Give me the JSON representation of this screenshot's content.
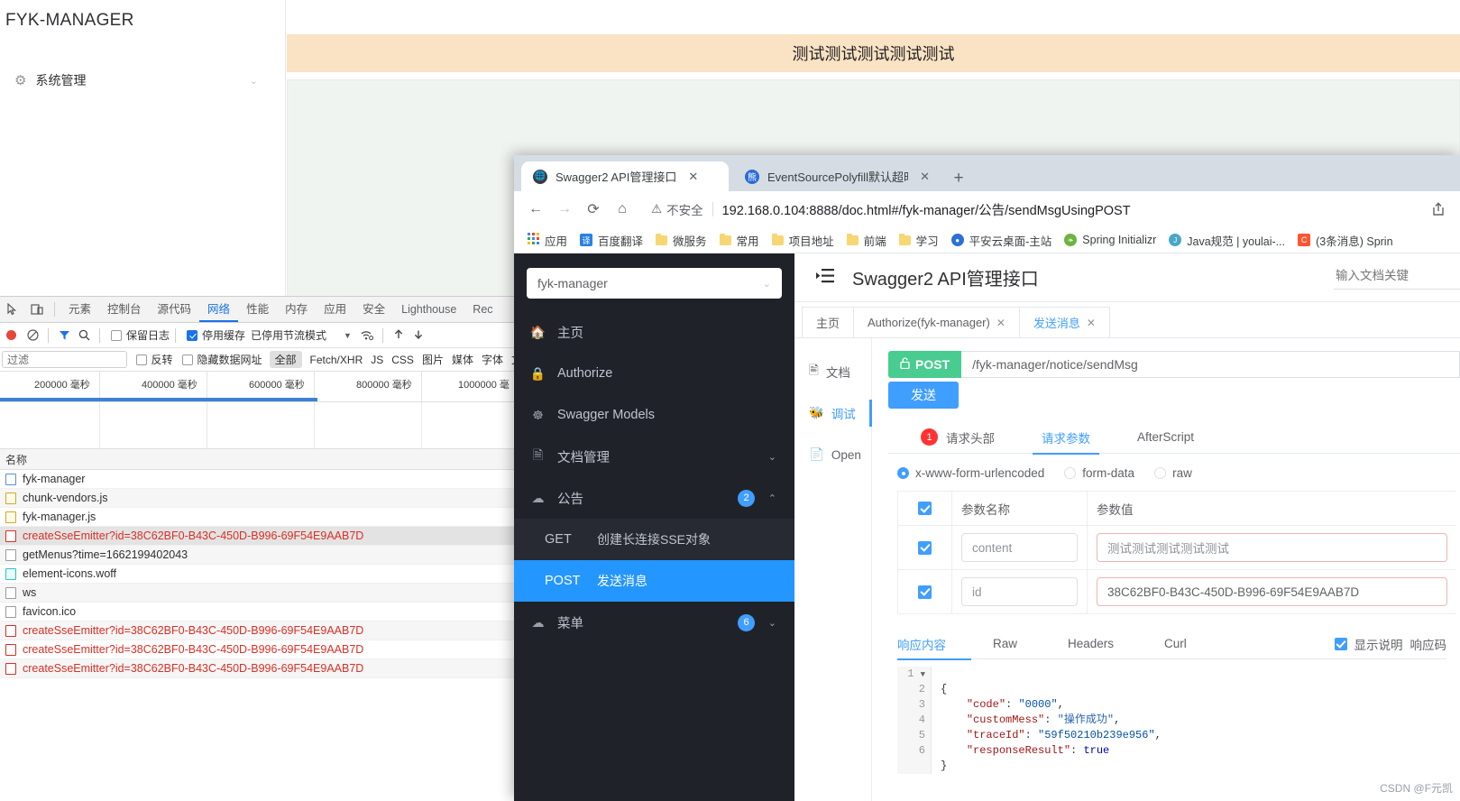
{
  "bg_app": {
    "logo": "FYK-MANAGER",
    "collapse_icon": "menu-fold-icon",
    "menu": {
      "label": "系统管理",
      "icon": "gear-icon",
      "chevron": "⌄"
    },
    "notice_text": "测试测试测试测试测试"
  },
  "devtools": {
    "inspect_icon": "inspect-element-icon",
    "device_icon": "device-toolbar-icon",
    "tabs": [
      {
        "label": "元素",
        "active": false
      },
      {
        "label": "控制台",
        "active": false
      },
      {
        "label": "源代码",
        "active": false
      },
      {
        "label": "网络",
        "active": true
      },
      {
        "label": "性能",
        "active": false
      },
      {
        "label": "内存",
        "active": false
      },
      {
        "label": "应用",
        "active": false
      },
      {
        "label": "安全",
        "active": false
      },
      {
        "label": "Lighthouse",
        "active": false
      },
      {
        "label": "Rec",
        "active": false
      }
    ],
    "toolbar": {
      "record_icon": "record-stop-icon",
      "clear_icon": "clear-icon",
      "filter_icon": "filter-funnel-icon",
      "search_icon": "search-icon",
      "preserve_log": "保留日志",
      "preserve_log_checked": false,
      "disable_cache": "停用缓存",
      "disable_cache_checked": true,
      "throttle": "已停用节流模式",
      "throttle_caret": "▼",
      "wifi_icon": "network-conditions-icon",
      "import_icon": "import-har-icon",
      "export_icon": "export-har-icon"
    },
    "filterbar": {
      "filter_placeholder": "过滤",
      "invert": "反转",
      "invert_checked": false,
      "hide_data_urls": "隐藏数据网址",
      "hide_data_urls_checked": false,
      "types": [
        "全部",
        "Fetch/XHR",
        "JS",
        "CSS",
        "图片",
        "媒体",
        "字体",
        "文"
      ],
      "selected_type": "全部"
    },
    "timeline_ticks": [
      "200000 毫秒",
      "400000 毫秒",
      "600000 毫秒",
      "800000 毫秒",
      "1000000 毫"
    ],
    "list_header": "名称",
    "requests": [
      {
        "name": "fyk-manager",
        "icon": "document-icon",
        "error": false,
        "selected": false
      },
      {
        "name": "chunk-vendors.js",
        "icon": "script-icon",
        "error": false,
        "selected": false
      },
      {
        "name": "fyk-manager.js",
        "icon": "script-icon",
        "error": false,
        "selected": false
      },
      {
        "name": "createSseEmitter?id=38C62BF0-B43C-450D-B996-69F54E9AAB7D",
        "icon": "other-icon",
        "error": true,
        "selected": true
      },
      {
        "name": "getMenus?time=1662199402043",
        "icon": "other-icon",
        "error": false,
        "selected": false
      },
      {
        "name": "element-icons.woff",
        "icon": "font-icon",
        "error": false,
        "selected": false
      },
      {
        "name": "ws",
        "icon": "other-icon",
        "error": false,
        "selected": false
      },
      {
        "name": "favicon.ico",
        "icon": "other-icon",
        "error": false,
        "selected": false
      },
      {
        "name": "createSseEmitter?id=38C62BF0-B43C-450D-B996-69F54E9AAB7D",
        "icon": "other-icon",
        "error": true,
        "selected": false
      },
      {
        "name": "createSseEmitter?id=38C62BF0-B43C-450D-B996-69F54E9AAB7D",
        "icon": "other-icon",
        "error": true,
        "selected": false
      },
      {
        "name": "createSseEmitter?id=38C62BF0-B43C-450D-B996-69F54E9AAB7D",
        "icon": "other-icon",
        "error": true,
        "selected": false
      }
    ]
  },
  "browser": {
    "tabs": [
      {
        "title": "Swagger2 API管理接口",
        "favicon": "globe-icon",
        "favicon_color": "#3c3c3c",
        "active": true
      },
      {
        "title": "EventSourcePolyfill默认超时时",
        "favicon": "baidu-icon",
        "favicon_color": "#2b6cd4",
        "active": false
      }
    ],
    "new_tab_label": "+",
    "nav": {
      "back": "←",
      "forward": "→",
      "reload": "⟳",
      "home": "⌂"
    },
    "security_label": "不安全",
    "security_icon": "warning-triangle-icon",
    "url": "192.168.0.104:8888/doc.html#/fyk-manager/公告/sendMsgUsingPOST",
    "share_icon": "share-icon",
    "bookmarks": [
      {
        "label": "应用",
        "icon": "apps-grid-icon",
        "type": "apps"
      },
      {
        "label": "百度翻译",
        "icon": "translate-icon",
        "type": "square",
        "color": "#2a7fe8",
        "glyph": "译"
      },
      {
        "label": "微服务",
        "icon": "folder-icon",
        "type": "folder"
      },
      {
        "label": "常用",
        "icon": "folder-icon",
        "type": "folder"
      },
      {
        "label": "项目地址",
        "icon": "folder-icon",
        "type": "folder"
      },
      {
        "label": "前端",
        "icon": "folder-icon",
        "type": "folder"
      },
      {
        "label": "学习",
        "icon": "folder-icon",
        "type": "folder"
      },
      {
        "label": "平安云桌面-主站",
        "icon": "pingan-icon",
        "type": "circle",
        "color": "#2e6fd8",
        "glyph": "●"
      },
      {
        "label": "Spring Initializr",
        "icon": "spring-leaf-icon",
        "type": "circle",
        "color": "#6db33f",
        "glyph": "❧"
      },
      {
        "label": "Java规范 | youlai-...",
        "icon": "java-icon",
        "type": "circle",
        "color": "#49a7c8",
        "glyph": "☕"
      },
      {
        "label": "(3条消息) Sprin",
        "icon": "csdn-icon",
        "type": "square",
        "color": "#fc5531",
        "glyph": "C"
      }
    ]
  },
  "swagger": {
    "service_select": {
      "value": "fyk-manager",
      "chevron": "⌄"
    },
    "sidebar": [
      {
        "label": "主页",
        "icon": "home-icon",
        "badge": null,
        "chevron": null
      },
      {
        "label": "Authorize",
        "icon": "lock-icon",
        "badge": null,
        "chevron": null
      },
      {
        "label": "Swagger Models",
        "icon": "cube-icon",
        "badge": null,
        "chevron": null
      },
      {
        "label": "文档管理",
        "icon": "doc-settings-icon",
        "badge": null,
        "chevron": "⌄"
      },
      {
        "label": "公告",
        "icon": "cloud-icon",
        "badge": "2",
        "chevron": "⌃"
      }
    ],
    "sidebar_sub": [
      {
        "method": "GET",
        "label": "创建长连接SSE对象",
        "active": false
      },
      {
        "method": "POST",
        "label": "发送消息",
        "active": true
      }
    ],
    "sidebar_after": [
      {
        "label": "菜单",
        "icon": "cloud-icon",
        "badge": "6",
        "chevron": "⌄"
      }
    ],
    "topbar": {
      "collapse_icon": "sidebar-collapse-icon",
      "title": "Swagger2 API管理接口",
      "search_placeholder": "输入文档关键"
    },
    "tabs": [
      {
        "label": "主页",
        "closable": false,
        "active": false
      },
      {
        "label": "Authorize(fyk-manager)",
        "closable": true,
        "active": false
      },
      {
        "label": "发送消息",
        "closable": true,
        "active": true
      }
    ],
    "left_nav": [
      {
        "label": "文档",
        "icon": "document-icon",
        "active": false
      },
      {
        "label": "调试",
        "icon": "bug-icon",
        "active": true
      },
      {
        "label": "Open",
        "icon": "open-file-icon",
        "active": false
      }
    ],
    "endpoint": {
      "method": "POST",
      "lock_icon": "unlock-icon",
      "path": "/fyk-manager/notice/sendMsg",
      "send_label": "发送"
    },
    "request_tabs": [
      {
        "label": "请求头部",
        "badge": "1",
        "active": false
      },
      {
        "label": "请求参数",
        "badge": null,
        "active": true
      },
      {
        "label": "AfterScript",
        "badge": null,
        "active": false
      }
    ],
    "body_types": [
      {
        "label": "x-www-form-urlencoded",
        "selected": true
      },
      {
        "label": "form-data",
        "selected": false
      },
      {
        "label": "raw",
        "selected": false
      }
    ],
    "param_table": {
      "headers": [
        "参数名称",
        "参数值"
      ],
      "header_checked": true,
      "rows": [
        {
          "checked": true,
          "name": "content",
          "value": "测试测试测试测试测试",
          "value_error": true
        },
        {
          "checked": true,
          "name": "id",
          "value": "38C62BF0-B43C-450D-B996-69F54E9AAB7D",
          "value_error": true
        }
      ]
    },
    "response_tabs": [
      {
        "label": "响应内容",
        "active": true
      },
      {
        "label": "Raw",
        "active": false
      },
      {
        "label": "Headers",
        "active": false
      },
      {
        "label": "Curl",
        "active": false
      }
    ],
    "response_right": {
      "show_desc_label": "显示说明",
      "show_desc_checked": true,
      "status_label": "响应码"
    },
    "response_json": {
      "lines": [
        "1",
        "2",
        "3",
        "4",
        "5",
        "6"
      ],
      "code": {
        "code": "0000",
        "customMess": "操作成功",
        "traceId": "59f50210b239e956",
        "responseResult": "true"
      }
    }
  },
  "watermark": "CSDN @F元凯"
}
